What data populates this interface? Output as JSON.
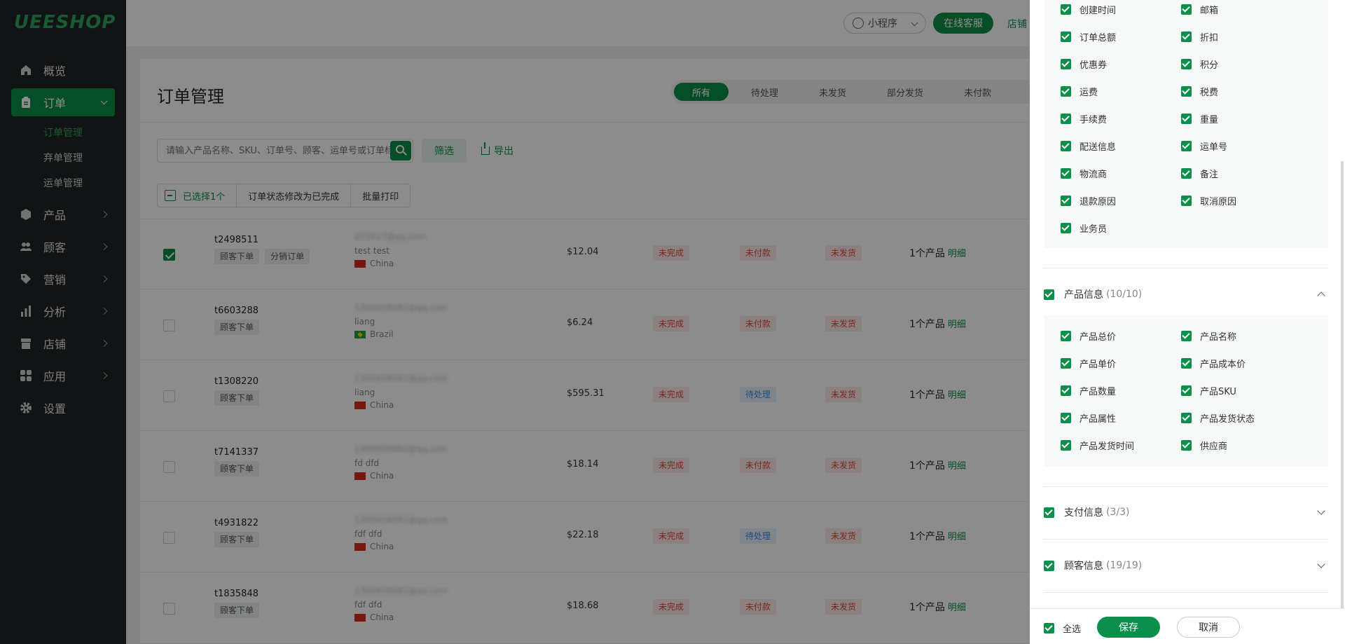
{
  "sidebar": {
    "logo": "UEESHOP",
    "items": [
      {
        "label": "概览",
        "icon": "home-icon"
      },
      {
        "label": "订单",
        "icon": "clipboard-icon"
      },
      {
        "label": "产品",
        "icon": "cube-icon"
      },
      {
        "label": "顾客",
        "icon": "users-icon"
      },
      {
        "label": "营销",
        "icon": "tag-icon"
      },
      {
        "label": "分析",
        "icon": "bar-chart-icon"
      },
      {
        "label": "店铺",
        "icon": "store-icon"
      },
      {
        "label": "应用",
        "icon": "apps-icon"
      },
      {
        "label": "设置",
        "icon": "gear-icon"
      }
    ],
    "sub_items": [
      "订单管理",
      "弃单管理",
      "运单管理"
    ]
  },
  "topbar": {
    "mini_program": "小程序",
    "service": "在线客服",
    "store": "店铺"
  },
  "main": {
    "title": "订单管理",
    "tabs": [
      "所有",
      "待处理",
      "未发货",
      "部分发货",
      "未付款"
    ],
    "search_placeholder": "请输入产品名称、SKU、订单号、顾客、运单号或订单标签",
    "filter": "筛选",
    "export": "导出",
    "bulk": {
      "selected": "已选择1个",
      "mark_complete": "订单状态修改为已完成",
      "print": "批量打印"
    }
  },
  "orders": [
    {
      "id": "t2498511",
      "tags": [
        "顾客下单",
        "分销订单"
      ],
      "email": "d72617@qq.com",
      "name": "test test",
      "country": "China",
      "amount": "$12.04",
      "s1": "未完成",
      "s2": "未付款",
      "s3": "未发货",
      "products": "1个产品",
      "detail": "明细"
    },
    {
      "id": "t6603288",
      "tags": [
        "顾客下单"
      ],
      "email": "1300458082@qq.com",
      "name": "liang",
      "country": "Brazil",
      "amount": "$6.24",
      "s1": "未完成",
      "s2": "未付款",
      "s3": "未发货",
      "products": "1个产品",
      "detail": "明细"
    },
    {
      "id": "t1308220",
      "tags": [
        "顾客下单"
      ],
      "email": "1300458082@qq.com",
      "name": "liang",
      "country": "China",
      "amount": "$595.31",
      "s1": "未完成",
      "s2": "待处理",
      "s3": "未发货",
      "products": "1个产品",
      "detail": "明细"
    },
    {
      "id": "t7141337",
      "tags": [
        "顾客下单"
      ],
      "email": "1300458082@qq.com",
      "name": "fd dfd",
      "country": "China",
      "amount": "$18.14",
      "s1": "未完成",
      "s2": "未付款",
      "s3": "未发货",
      "products": "1个产品",
      "detail": "明细"
    },
    {
      "id": "t4931822",
      "tags": [
        "顾客下单"
      ],
      "email": "1300458082@qq.com",
      "name": "fdf dfd",
      "country": "China",
      "amount": "$22.18",
      "s1": "未完成",
      "s2": "待处理",
      "s3": "未发货",
      "products": "1个产品",
      "detail": "明细"
    },
    {
      "id": "t1835848",
      "tags": [
        "顾客下单"
      ],
      "email": "1300458082@qq.com",
      "name": "fdf dfd",
      "country": "China",
      "amount": "$18.68",
      "s1": "未完成",
      "s2": "未付款",
      "s3": "未发货",
      "products": "1个产品",
      "detail": "明细"
    }
  ],
  "drawer": {
    "order_fields_left": [
      "创建时间",
      "订单总额",
      "优惠券",
      "运费",
      "手续费",
      "配送信息",
      "物流商",
      "退款原因",
      "业务员"
    ],
    "order_fields_right": [
      "邮箱",
      "折扣",
      "积分",
      "税费",
      "重量",
      "运单号",
      "备注",
      "取消原因"
    ],
    "product_section": {
      "label": "产品信息",
      "count": "(10/10)"
    },
    "product_fields_left": [
      "产品总价",
      "产品单价",
      "产品数量",
      "产品属性",
      "产品发货时间"
    ],
    "product_fields_right": [
      "产品名称",
      "产品成本价",
      "产品SKU",
      "产品发货状态",
      "供应商"
    ],
    "payment_section": {
      "label": "支付信息",
      "count": "(3/3)"
    },
    "customer_section": {
      "label": "顾客信息",
      "count": "(19/19)"
    },
    "select_all": "全选",
    "save": "保存",
    "cancel": "取消"
  },
  "colors": {
    "brand": "#0b8f4a",
    "sidebar": "#1f2425",
    "danger": "#e0463a",
    "info": "#3a8be0"
  }
}
